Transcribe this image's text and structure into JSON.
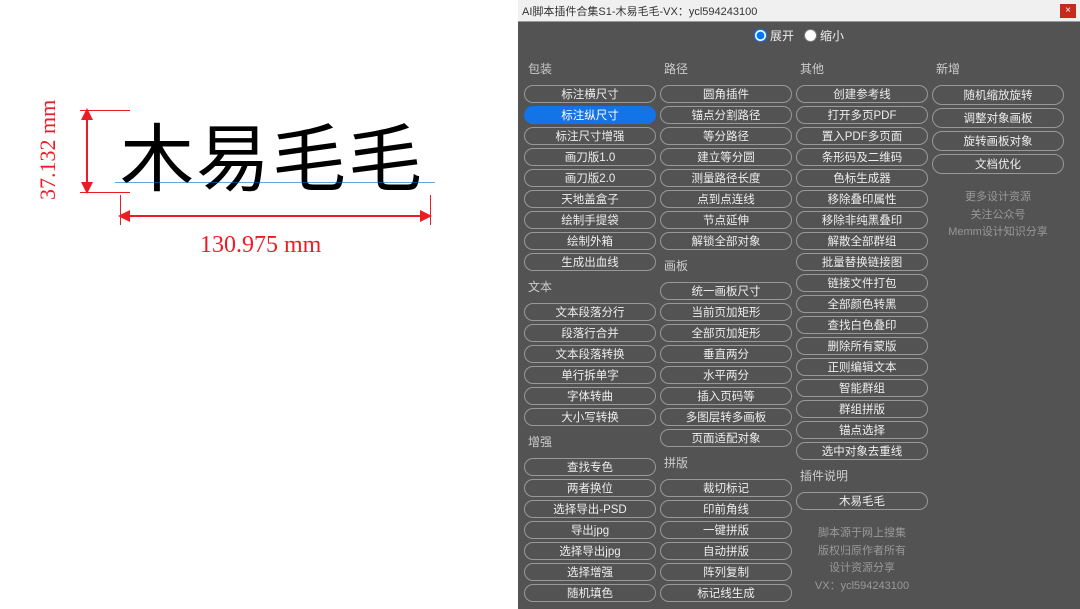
{
  "canvas": {
    "sample_text": "木易毛毛",
    "dim_v": "37.132 mm",
    "dim_h": "130.975 mm"
  },
  "titlebar": {
    "title": "AI脚本插件合集S1-木易毛毛-VX：ycl594243100",
    "close": "×"
  },
  "view_toggle": {
    "expand": "展开",
    "collapse": "缩小"
  },
  "columns": [
    {
      "groups": [
        {
          "title": "包装",
          "items": [
            "标注横尺寸",
            "标注纵尺寸",
            "标注尺寸增强",
            "画刀版1.0",
            "画刀版2.0",
            "天地盖盒子",
            "绘制手提袋",
            "绘制外箱",
            "生成出血线"
          ]
        },
        {
          "title": "文本",
          "items": [
            "文本段落分行",
            "段落行合并",
            "文本段落转换",
            "单行拆单字",
            "字体转曲",
            "大小写转换"
          ]
        },
        {
          "title": "增强",
          "items": [
            "查找专色",
            "两者换位",
            "选择导出-PSD",
            "导出jpg",
            "选择导出jpg",
            "选择增强",
            "随机填色"
          ]
        }
      ]
    },
    {
      "groups": [
        {
          "title": "路径",
          "items": [
            "圆角插件",
            "锚点分割路径",
            "等分路径",
            "建立等分圆",
            "测量路径长度",
            "点到点连线",
            "节点延伸",
            "解锁全部对象"
          ]
        },
        {
          "title": "画板",
          "items": [
            "统一画板尺寸",
            "当前页加矩形",
            "全部页加矩形",
            "垂直两分",
            "水平两分",
            "插入页码等",
            "多图层转多画板",
            "页面适配对象"
          ]
        },
        {
          "title": "拼版",
          "items": [
            "裁切标记",
            "印前角线",
            "一键拼版",
            "自动拼版",
            "阵列复制",
            "标记线生成"
          ]
        }
      ]
    },
    {
      "groups": [
        {
          "title": "其他",
          "items": [
            "创建参考线",
            "打开多页PDF",
            "置入PDF多页面",
            "条形码及二维码",
            "色标生成器",
            "移除叠印属性",
            "移除非纯黑叠印",
            "解散全部群组",
            "批量替换链接图",
            "链接文件打包",
            "全部颜色转黑",
            "查找白色叠印",
            "删除所有蒙版",
            "正则编辑文本",
            "智能群组",
            "群组拼版",
            "锚点选择",
            "选中对象去重线"
          ]
        },
        {
          "title": "插件说明",
          "items": [
            "木易毛毛"
          ],
          "credit": [
            "脚本源于网上搜集",
            "版权归原作者所有",
            "",
            "设计资源分享",
            "VX：ycl594243100"
          ]
        }
      ]
    },
    {
      "groups": [
        {
          "title": "新增",
          "items": [
            "随机缩放旋转",
            "调整对象画板",
            "旋转画板对象",
            "文档优化"
          ],
          "credit": [
            "更多设计资源",
            "关注公众号",
            "Memm设计知识分享"
          ]
        }
      ]
    }
  ],
  "active_pill": "标注纵尺寸"
}
